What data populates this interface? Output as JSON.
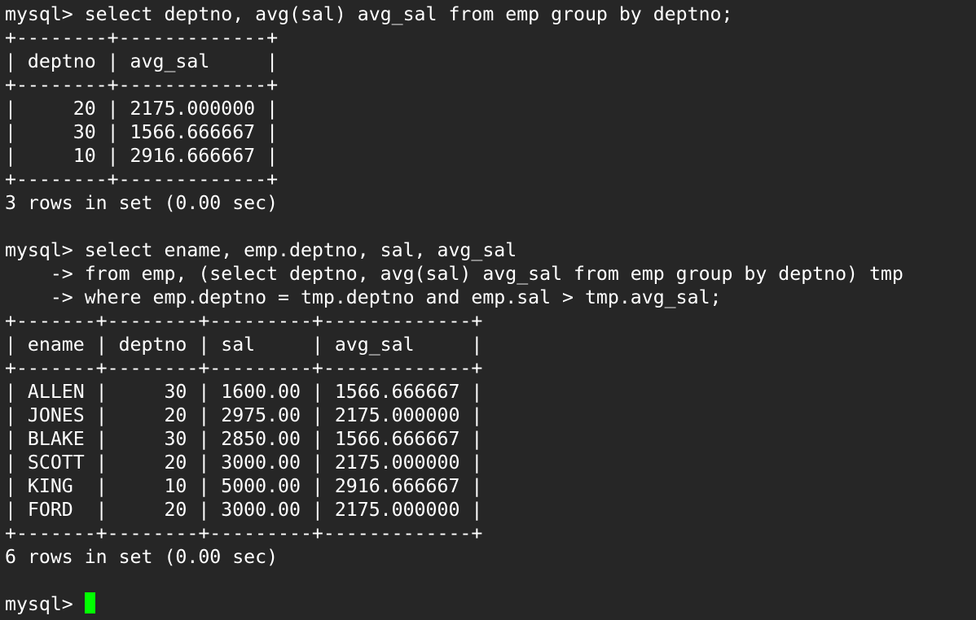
{
  "colors": {
    "background": "#262626",
    "text": "#ffffff",
    "cursor": "#00ff00"
  },
  "terminal": {
    "lines": [
      "mysql> select deptno, avg(sal) avg_sal from emp group by deptno;",
      "+--------+-------------+",
      "| deptno | avg_sal     |",
      "+--------+-------------+",
      "|     20 | 2175.000000 |",
      "|     30 | 1566.666667 |",
      "|     10 | 2916.666667 |",
      "+--------+-------------+",
      "3 rows in set (0.00 sec)",
      "",
      "mysql> select ename, emp.deptno, sal, avg_sal",
      "    -> from emp, (select deptno, avg(sal) avg_sal from emp group by deptno) tmp",
      "    -> where emp.deptno = tmp.deptno and emp.sal > tmp.avg_sal;",
      "+-------+--------+---------+-------------+",
      "| ename | deptno | sal     | avg_sal     |",
      "+-------+--------+---------+-------------+",
      "| ALLEN |     30 | 1600.00 | 1566.666667 |",
      "| JONES |     20 | 2975.00 | 2175.000000 |",
      "| BLAKE |     30 | 2850.00 | 1566.666667 |",
      "| SCOTT |     20 | 3000.00 | 2175.000000 |",
      "| KING  |     10 | 5000.00 | 2916.666667 |",
      "| FORD  |     20 | 3000.00 | 2175.000000 |",
      "+-------+--------+---------+-------------+",
      "6 rows in set (0.00 sec)",
      ""
    ],
    "prompt": "mysql> "
  }
}
